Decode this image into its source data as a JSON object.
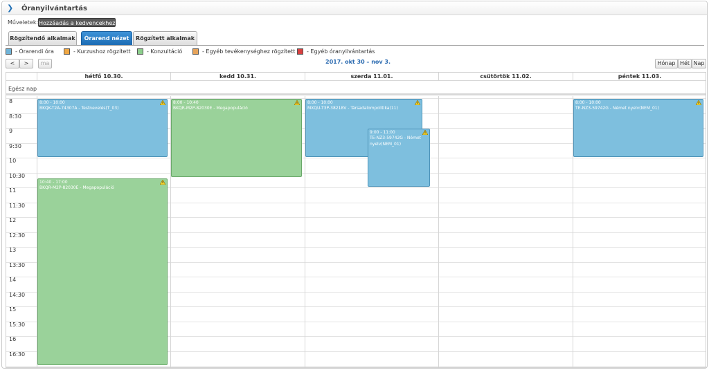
{
  "page": {
    "title": "Óranyilvántartás"
  },
  "actions": {
    "label": "Műveletek:",
    "favorite_button": "Hozzáadás a kedvencekhez"
  },
  "tabs": [
    {
      "label": "Rögzítendő alkalmak",
      "active": false
    },
    {
      "label": "Órarend nézet",
      "active": true
    },
    {
      "label": "Rögzített alkalmak",
      "active": false
    }
  ],
  "legend": [
    {
      "label": "- Órarendi óra",
      "color": "#6fb4d9"
    },
    {
      "label": "- Kurzushoz rögzített",
      "color": "#f0a742"
    },
    {
      "label": "- Konzultáció",
      "color": "#8ccf8c"
    },
    {
      "label": "- Egyéb tevékenységhez rögzített",
      "color": "#e6a35a"
    },
    {
      "label": "- Egyéb óranyilvántartás",
      "color": "#d94040"
    }
  ],
  "nav": {
    "prev_glyph": "<",
    "next_glyph": ">",
    "today_label": "ma",
    "range": "2017. okt 30 – nov 3.",
    "views": [
      "Hónap",
      "Hét",
      "Nap"
    ]
  },
  "calendar": {
    "allday_label": "Egész nap",
    "days": [
      "hétfő 10.30.",
      "kedd 10.31.",
      "szerda 11.01.",
      "csütörtök 11.02.",
      "péntek 11.03."
    ],
    "time_labels": [
      "8",
      "8:30",
      "9",
      "9:30",
      "10",
      "10:30",
      "11",
      "11:30",
      "12",
      "12:30",
      "13",
      "13:30",
      "14",
      "14:30",
      "15",
      "15:30",
      "16",
      "16:30"
    ],
    "events": [
      {
        "day": 0,
        "start": 8.0,
        "end": 10.0,
        "time": "8:00 - 10:00",
        "title": "BKQK-T2A-74307A - Testnevelés(T_03)",
        "color": "blue",
        "lane": 0,
        "lanes": 1
      },
      {
        "day": 0,
        "start": 10.67,
        "end": 17.0,
        "time": "10:40 - 17:00",
        "title": "BKQR-M2P-82030E - Megapopuláció",
        "color": "green",
        "lane": 0,
        "lanes": 1
      },
      {
        "day": 1,
        "start": 8.0,
        "end": 10.67,
        "time": "8:00 - 10:40",
        "title": "BKQR-M2P-82030E - Megapopuláció",
        "color": "green",
        "lane": 0,
        "lanes": 1
      },
      {
        "day": 2,
        "start": 8.0,
        "end": 10.0,
        "time": "8:00 - 10:00",
        "title": "MXQU-T3P-38218V - Társadalompolitika(11)",
        "color": "blue",
        "lane": 0,
        "lanes": 1
      },
      {
        "day": 2,
        "start": 9.0,
        "end": 11.0,
        "time": "9:00 - 11:00",
        "title": "TE-NZ3-59742G - Német nyelv(NEM_01)",
        "color": "blue",
        "lane": 1,
        "lanes": 2
      },
      {
        "day": 4,
        "start": 8.0,
        "end": 10.0,
        "time": "8:00 - 10:00",
        "title": "TE-NZ3-59742G - Német nyelv(NEM_01)",
        "color": "blue",
        "lane": 0,
        "lanes": 1
      }
    ]
  }
}
